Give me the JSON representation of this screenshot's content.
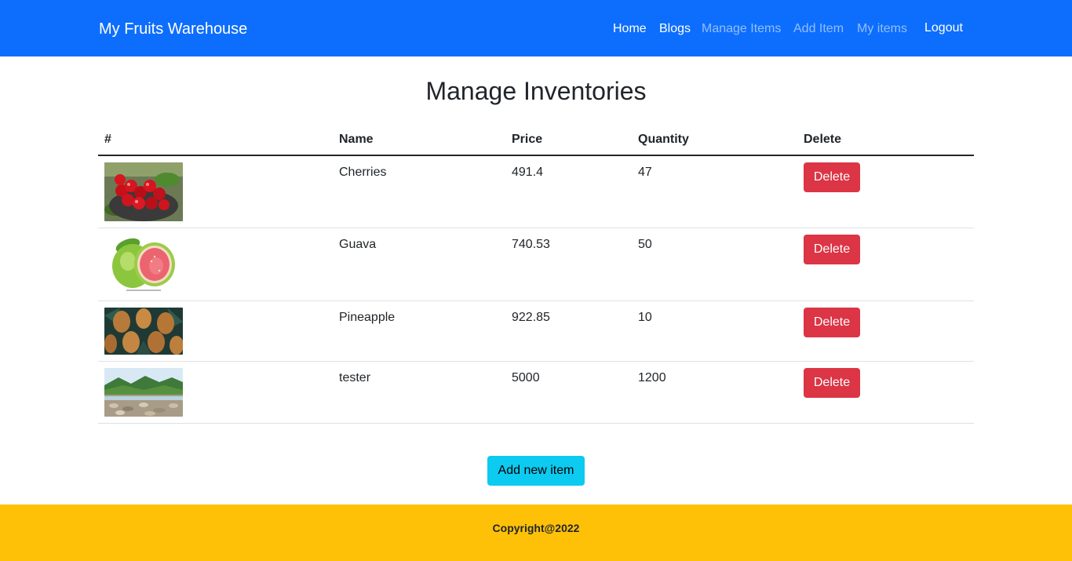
{
  "navbar": {
    "brand": "My Fruits Warehouse",
    "links": [
      {
        "label": "Home",
        "active": true
      },
      {
        "label": "Blogs",
        "active": true
      },
      {
        "label": "Manage Items",
        "active": false
      },
      {
        "label": "Add Item",
        "active": false
      },
      {
        "label": "My items",
        "active": false
      },
      {
        "label": "Logout",
        "active": true
      }
    ],
    "color": "#0d6efd"
  },
  "main": {
    "title": "Manage Inventories",
    "table": {
      "headers": [
        "#",
        "Name",
        "Price",
        "Quantity",
        "Delete"
      ],
      "rows": [
        {
          "image": "cherries-photo",
          "name": "Cherries",
          "price": "491.4",
          "quantity": "47",
          "delete_label": "Delete"
        },
        {
          "image": "guava-photo",
          "name": "Guava",
          "price": "740.53",
          "quantity": "50",
          "delete_label": "Delete"
        },
        {
          "image": "pineapple-photo",
          "name": "Pineapple",
          "price": "922.85",
          "quantity": "10",
          "delete_label": "Delete"
        },
        {
          "image": "river-landscape-photo",
          "name": "tester",
          "price": "5000",
          "quantity": "1200",
          "delete_label": "Delete"
        }
      ]
    },
    "add_button_label": "Add new item"
  },
  "footer": {
    "text": "Copyright@2022",
    "color": "#ffc107"
  },
  "colors": {
    "danger": "#dc3545",
    "info": "#0dcaf0"
  }
}
